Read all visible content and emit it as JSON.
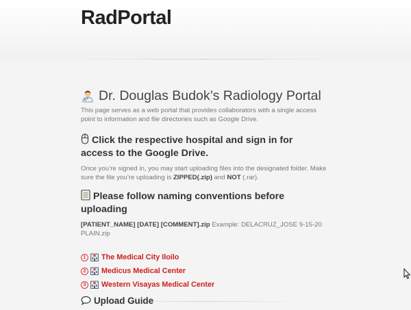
{
  "site": {
    "title": "RadPortal"
  },
  "intro": {
    "title_icon": "doctor-icon",
    "title": "Dr. Douglas Budok’s Radiology Portal",
    "description": "This page serves as a web portal that provides collaborators with a single access point to information and file directories such as Google Drive."
  },
  "signin": {
    "icon": "mouse-icon",
    "heading": "Click the respective hospital and sign in for access to the Google Drive.",
    "text_before": "Once you’re signed in, you may start uploading files into the designated folder. Make sure the file you’re uploading is ",
    "zipped": "ZIPPED(.zip)",
    "text_and": " and ",
    "not_word": "NOT",
    "text_after": " (.rar)."
  },
  "naming": {
    "icon": "ledger-icon",
    "heading": "Please follow naming conventions before uploading",
    "pattern": "[PATIENT_NAME] [DATE] [COMMENT].zip",
    "example": " Example: DELACRUZ_JOSE 9-15-20 PLAIN.zip"
  },
  "hospitals": [
    {
      "number": "1",
      "icon": "hospital-icon",
      "name": "The Medical City Iloilo"
    },
    {
      "number": "2",
      "icon": "hospital-icon",
      "name": "Medicus Medical Center"
    },
    {
      "number": "3",
      "icon": "hospital-icon",
      "name": "Western Visayas Medical Center"
    }
  ],
  "upload_guide": {
    "icon": "speech-bubble-icon",
    "label": "Upload Guide"
  },
  "colors": {
    "link": "#cc1f1f",
    "number_circle": "#e0312f"
  }
}
